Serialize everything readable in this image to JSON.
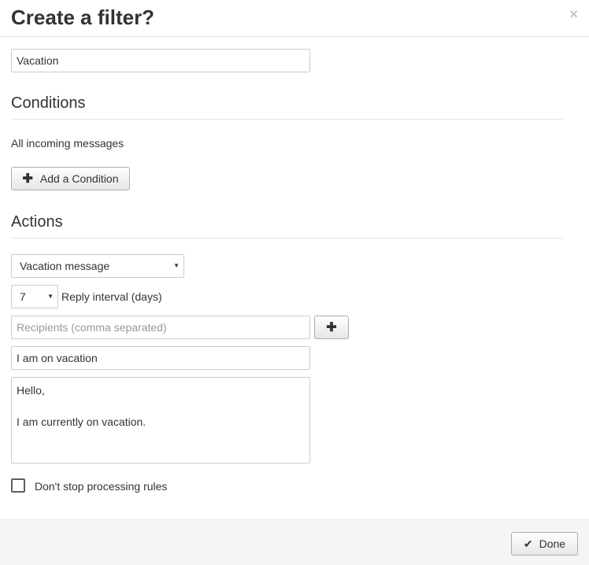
{
  "header": {
    "title": "Create a filter?",
    "close_glyph": "×"
  },
  "filter_name": {
    "value": "Vacation"
  },
  "conditions": {
    "heading": "Conditions",
    "summary": "All incoming messages",
    "add_button_label": "Add a Condition",
    "add_icon": "plus-icon"
  },
  "actions": {
    "heading": "Actions",
    "action_type": "Vacation message",
    "reply_interval_value": "7",
    "reply_interval_label": "Reply interval (days)",
    "recipients_placeholder": "Recipients (comma separated)",
    "add_recipient_icon": "plus-icon",
    "subject_value": "I am on vacation",
    "body_lines": [
      "Hello,",
      "",
      "I am currently on vacation."
    ],
    "dont_stop_label": "Don't stop processing rules",
    "dont_stop_checked": false
  },
  "footer": {
    "done_label": "Done",
    "done_icon": "check-icon"
  }
}
